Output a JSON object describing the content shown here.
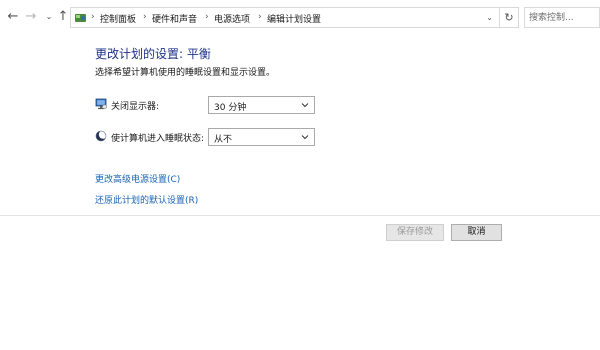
{
  "nav": {
    "back_icon": "back-arrow",
    "forward_icon": "forward-arrow",
    "recent_icon": "chevron-down",
    "up_icon": "up-arrow",
    "breadcrumbs": [
      "控制面板",
      "硬件和声音",
      "电源选项",
      "编辑计划设置"
    ],
    "search_placeholder": "搜索控制..."
  },
  "main": {
    "title": "更改计划的设置: 平衡",
    "subtitle": "选择希望计算机使用的睡眠设置和显示设置。",
    "settings": [
      {
        "label": "关闭显示器:",
        "value": "30 分钟",
        "icon": "monitor-icon"
      },
      {
        "label": "使计算机进入睡眠状态:",
        "value": "从不",
        "icon": "moon-icon"
      }
    ],
    "links": [
      {
        "label": "更改高级电源设置(C)"
      },
      {
        "label": "还原此计划的默认设置(R)"
      }
    ]
  },
  "footer": {
    "save_label": "保存修改",
    "cancel_label": "取消"
  },
  "colors": {
    "title": "#1e3287",
    "link": "#1a64b4"
  }
}
